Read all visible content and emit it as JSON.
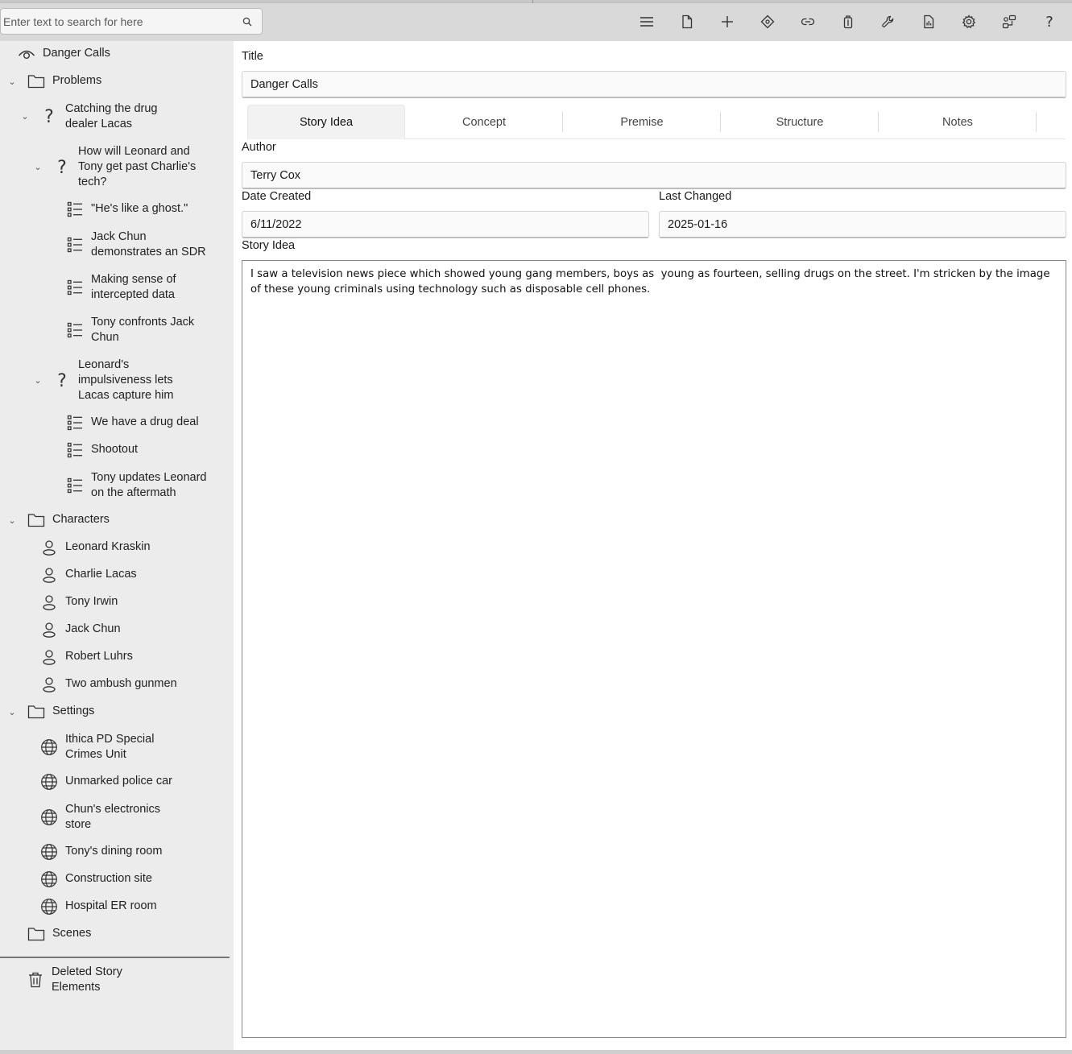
{
  "search": {
    "placeholder": "Enter text to search for here"
  },
  "toolbar": {
    "icons": [
      "menu-icon",
      "new-file-icon",
      "add-icon",
      "move-icon",
      "link-icon",
      "copy-icon",
      "tools-icon",
      "report-icon",
      "settings-icon",
      "collaborate-icon",
      "help-icon"
    ],
    "help_label": "?"
  },
  "sidebar": {
    "root": "Danger Calls",
    "problems": {
      "label": "Problems",
      "items": [
        "Catching the drug dealer Lacas",
        "How will Leonard and Tony get past Charlie's tech?",
        "\"He's like a ghost.\"",
        "Jack Chun demonstrates an SDR",
        "Making sense of intercepted data",
        "Tony confronts Jack Chun",
        "Leonard's impulsiveness lets Lacas capture him",
        "We have a drug deal",
        "Shootout",
        "Tony updates Leonard on the aftermath"
      ]
    },
    "characters": {
      "label": "Characters",
      "items": [
        "Leonard Kraskin",
        "Charlie Lacas",
        "Tony Irwin",
        "Jack Chun",
        "Robert Luhrs",
        "Two ambush gunmen"
      ]
    },
    "settings": {
      "label": "Settings",
      "items": [
        "Ithica PD Special Crimes Unit",
        "Unmarked police car",
        "Chun's electronics store",
        "Tony's dining room",
        "Construction site",
        "Hospital ER room"
      ]
    },
    "scenes": {
      "label": "Scenes"
    },
    "deleted": {
      "label": "Deleted Story Elements"
    }
  },
  "form": {
    "title_label": "Title",
    "title_value": "Danger Calls",
    "tabs": [
      "Story Idea",
      "Concept",
      "Premise",
      "Structure",
      "Notes"
    ],
    "author_label": "Author",
    "author_value": "Terry Cox",
    "date_created_label": "Date Created",
    "date_created_value": "6/11/2022",
    "last_changed_label": "Last Changed",
    "last_changed_value": "2025-01-16",
    "story_idea_label": "Story Idea",
    "story_idea_value": "I saw a television news piece which showed young gang members, boys as  young as fourteen, selling drugs on the street. I'm stricken by the image of these young criminals using technology such as disposable cell phones."
  }
}
